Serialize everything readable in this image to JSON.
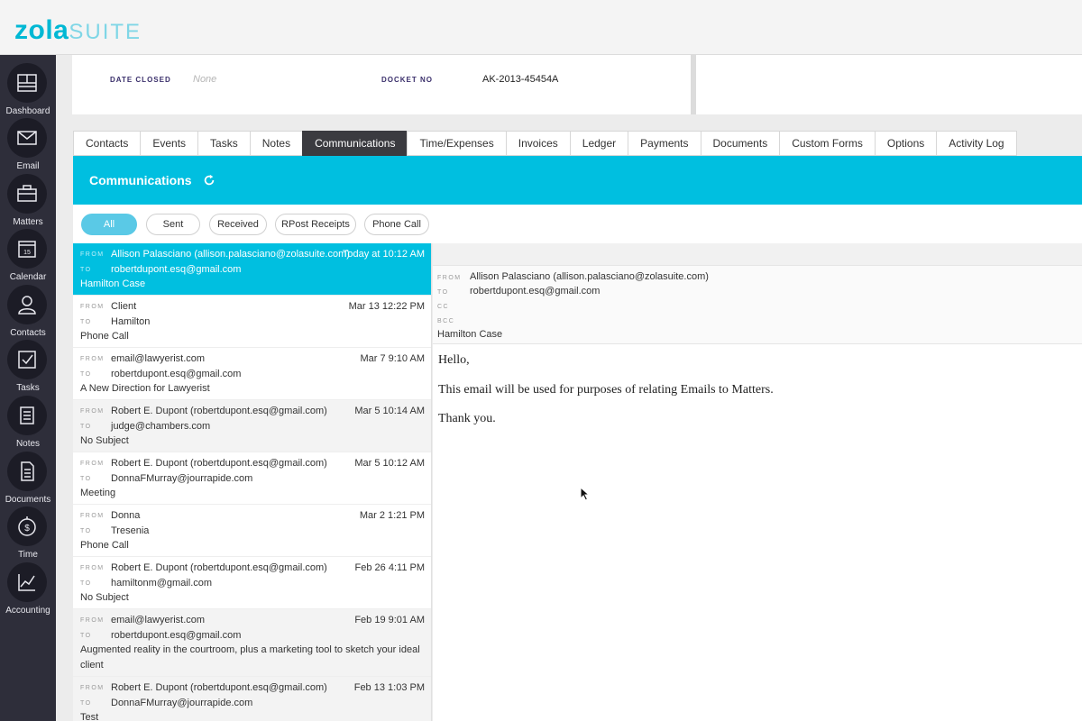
{
  "brand": {
    "logo_primary": "zola",
    "logo_secondary": "SUITE",
    "accent_color": "#00bfe0"
  },
  "sidebar": {
    "items": [
      {
        "label": "Dashboard",
        "icon": "dashboard-icon"
      },
      {
        "label": "Email",
        "icon": "envelope-icon"
      },
      {
        "label": "Matters",
        "icon": "briefcase-icon"
      },
      {
        "label": "Calendar",
        "icon": "calendar-icon",
        "icon_text": "15"
      },
      {
        "label": "Contacts",
        "icon": "person-icon"
      },
      {
        "label": "Tasks",
        "icon": "checkbox-icon"
      },
      {
        "label": "Notes",
        "icon": "notepad-icon"
      },
      {
        "label": "Documents",
        "icon": "document-icon"
      },
      {
        "label": "Time",
        "icon": "stopwatch-dollar-icon",
        "icon_text": "$"
      },
      {
        "label": "Accounting",
        "icon": "line-chart-icon"
      }
    ]
  },
  "matter": {
    "date_closed_label": "DATE CLOSED",
    "date_closed_value": "None",
    "docket_label": "DOCKET NO",
    "docket_value": "AK-2013-45454A"
  },
  "tabs": [
    "Contacts",
    "Events",
    "Tasks",
    "Notes",
    "Communications",
    "Time/Expenses",
    "Invoices",
    "Ledger",
    "Payments",
    "Documents",
    "Custom Forms",
    "Options",
    "Activity Log"
  ],
  "active_tab": "Communications",
  "section": {
    "title": "Communications",
    "refresh_icon": "refresh-icon"
  },
  "filters": [
    "All",
    "Sent",
    "Received",
    "RPost Receipts",
    "Phone Call"
  ],
  "active_filter": "All",
  "field_labels": {
    "from": "FROM",
    "to": "TO",
    "cc": "CC",
    "bcc": "BCC"
  },
  "messages": [
    {
      "from": "Allison Palasciano (allison.palasciano@zolasuite.com)",
      "to": "robertdupont.esq@gmail.com",
      "date": "Today at 10:12 AM",
      "subject": "Hamilton Case"
    },
    {
      "from": "Client",
      "to": "Hamilton",
      "date": "Mar 13 12:22 PM",
      "subject": "Phone Call"
    },
    {
      "from": "email@lawyerist.com",
      "to": "robertdupont.esq@gmail.com",
      "date": "Mar 7 9:10 AM",
      "subject": "A New Direction for Lawyerist"
    },
    {
      "from": "Robert E. Dupont (robertdupont.esq@gmail.com)",
      "to": "judge@chambers.com",
      "date": "Mar 5 10:14 AM",
      "subject": "No Subject"
    },
    {
      "from": "Robert E. Dupont (robertdupont.esq@gmail.com)",
      "to": "DonnaFMurray@jourrapide.com",
      "date": "Mar 5 10:12 AM",
      "subject": "Meeting"
    },
    {
      "from": "Donna",
      "to": "Tresenia",
      "date": "Mar 2 1:21 PM",
      "subject": "Phone Call"
    },
    {
      "from": "Robert E. Dupont (robertdupont.esq@gmail.com)",
      "to": "hamiltonm@gmail.com",
      "date": "Feb 26 4:11 PM",
      "subject": "No Subject"
    },
    {
      "from": "email@lawyerist.com",
      "to": "robertdupont.esq@gmail.com",
      "date": "Feb 19 9:01 AM",
      "subject": "Augmented reality in the courtroom, plus a marketing tool to sketch your ideal client"
    },
    {
      "from": "Robert E. Dupont (robertdupont.esq@gmail.com)",
      "to": "DonnaFMurray@jourrapide.com",
      "date": "Feb 13 1:03 PM",
      "subject": "Test"
    }
  ],
  "detail": {
    "from": "Allison Palasciano (allison.palasciano@zolasuite.com)",
    "to": "robertdupont.esq@gmail.com",
    "cc": "",
    "bcc": "",
    "subject": "Hamilton Case",
    "body": [
      "Hello,",
      "This email will be used for purposes of relating Emails to Matters.",
      "Thank you."
    ]
  }
}
